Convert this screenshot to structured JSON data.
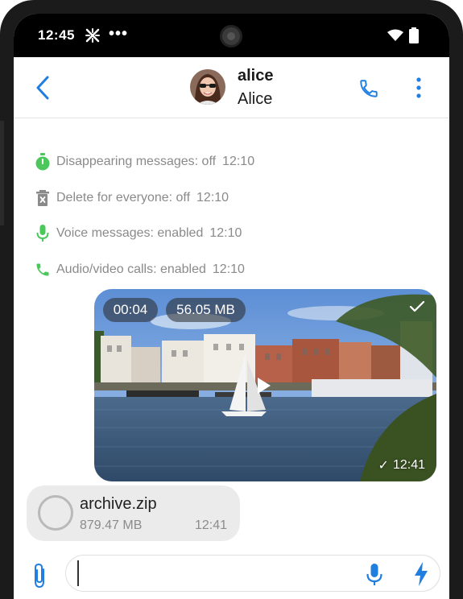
{
  "statusbar": {
    "time": "12:45",
    "dots": "•••"
  },
  "header": {
    "contact_name": "alice",
    "contact_full_name": "Alice"
  },
  "events": [
    {
      "icon": "timer-icon",
      "text": "Disappearing messages: off",
      "time": "12:10",
      "color": "#4cc75c"
    },
    {
      "icon": "trash-icon",
      "text": "Delete for everyone: off",
      "time": "12:10",
      "color": "#8a8a8a"
    },
    {
      "icon": "mic-icon",
      "text": "Voice messages: enabled",
      "time": "12:10",
      "color": "#4cc75c"
    },
    {
      "icon": "phone-icon",
      "text": "Audio/video calls: enabled",
      "time": "12:10",
      "color": "#4cc75c"
    }
  ],
  "video_message": {
    "duration": "00:04",
    "size": "56.05 MB",
    "time": "12:41",
    "check": "✓"
  },
  "file_message": {
    "name": "archive.zip",
    "size": "879.47 MB",
    "time": "12:41"
  },
  "compose": {
    "placeholder": ""
  },
  "colors": {
    "accent": "#1f7ee0",
    "green": "#4cc75c",
    "muted": "#8a8a8a"
  }
}
